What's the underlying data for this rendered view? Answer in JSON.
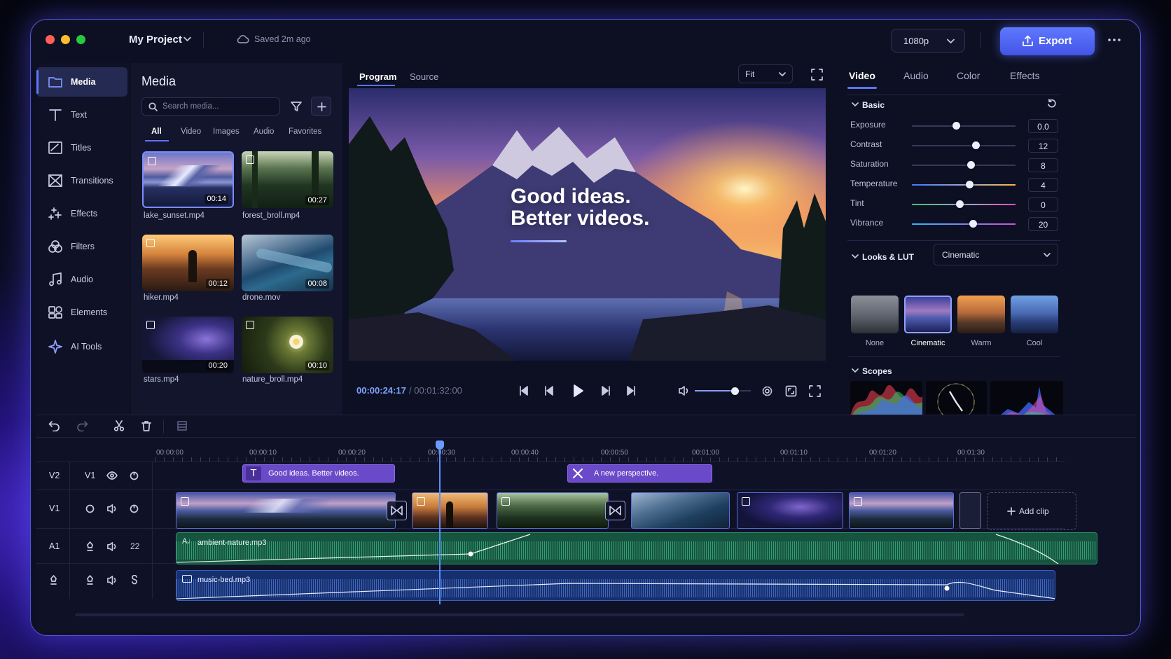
{
  "window": {
    "project_name": "My Project",
    "saved_status": "Saved 2m ago",
    "resolution": "1080p",
    "export_label": "Export"
  },
  "nav": {
    "items": [
      {
        "label": "Media"
      },
      {
        "label": "Text"
      },
      {
        "label": "Titles"
      },
      {
        "label": "Transitions"
      },
      {
        "label": "Effects"
      },
      {
        "label": "Filters"
      },
      {
        "label": "Audio"
      },
      {
        "label": "Elements"
      },
      {
        "label": "AI Tools"
      }
    ]
  },
  "media": {
    "title": "Media",
    "search_placeholder": "Search media...",
    "tabs": [
      "All",
      "Video",
      "Images",
      "Audio",
      "Favorites"
    ],
    "items": [
      {
        "name": "lake_sunset.mp4",
        "duration": "00:14"
      },
      {
        "name": "forest_broll.mp4",
        "duration": "00:27"
      },
      {
        "name": "hiker.mp4",
        "duration": "00:12"
      },
      {
        "name": "drone.mov",
        "duration": "00:08"
      },
      {
        "name": "stars.mp4",
        "duration": "00:20"
      },
      {
        "name": "nature_broll.mp4",
        "duration": "00:10"
      }
    ]
  },
  "viewer": {
    "tabs": [
      "Program",
      "Source"
    ],
    "zoom": "Fit",
    "overlay_line1": "Good ideas.",
    "overlay_line2": "Better videos.",
    "timecode": "00:00:24:17",
    "total": "/  00:01:32:00",
    "volume": 0.72
  },
  "inspector": {
    "tabs": [
      "Video",
      "Audio",
      "Color",
      "Effects"
    ],
    "basic_title": "Basic",
    "adjustments": [
      {
        "label": "Exposure",
        "value": "0.0",
        "pos": 0.43
      },
      {
        "label": "Contrast",
        "value": "12",
        "pos": 0.62
      },
      {
        "label": "Saturation",
        "value": "8",
        "pos": 0.57
      },
      {
        "label": "Temperature",
        "value": "4",
        "pos": 0.56
      },
      {
        "label": "Tint",
        "value": "0",
        "pos": 0.46
      },
      {
        "label": "Vibrance",
        "value": "20",
        "pos": 0.59
      }
    ],
    "looks_title": "Looks & LUT",
    "looks_selected": "Cinematic",
    "looks": [
      "None",
      "Cinematic",
      "Warm",
      "Cool"
    ],
    "scopes_title": "Scopes"
  },
  "timeline": {
    "ticks": [
      "00:00:00",
      "00:00:10",
      "00:00:20",
      "00:00:30",
      "00:00:40",
      "00:00:50",
      "00:01:00",
      "00:01:10",
      "00:01:20",
      "00:01:30"
    ],
    "tracks": [
      "V2",
      "V1",
      "A1"
    ],
    "text_clips": [
      "Good ideas. Better videos.",
      "A new perspective."
    ],
    "audio_clips": [
      "ambient-nature.mp3",
      "music-bed.mp3"
    ],
    "add_clip": "Add clip",
    "a1_level": "22"
  },
  "colors": {
    "accent": "#5b74ff",
    "audio_green": "#3fae86",
    "audio_blue": "#3c6fd6",
    "title_clip": "#6b4ac9"
  }
}
